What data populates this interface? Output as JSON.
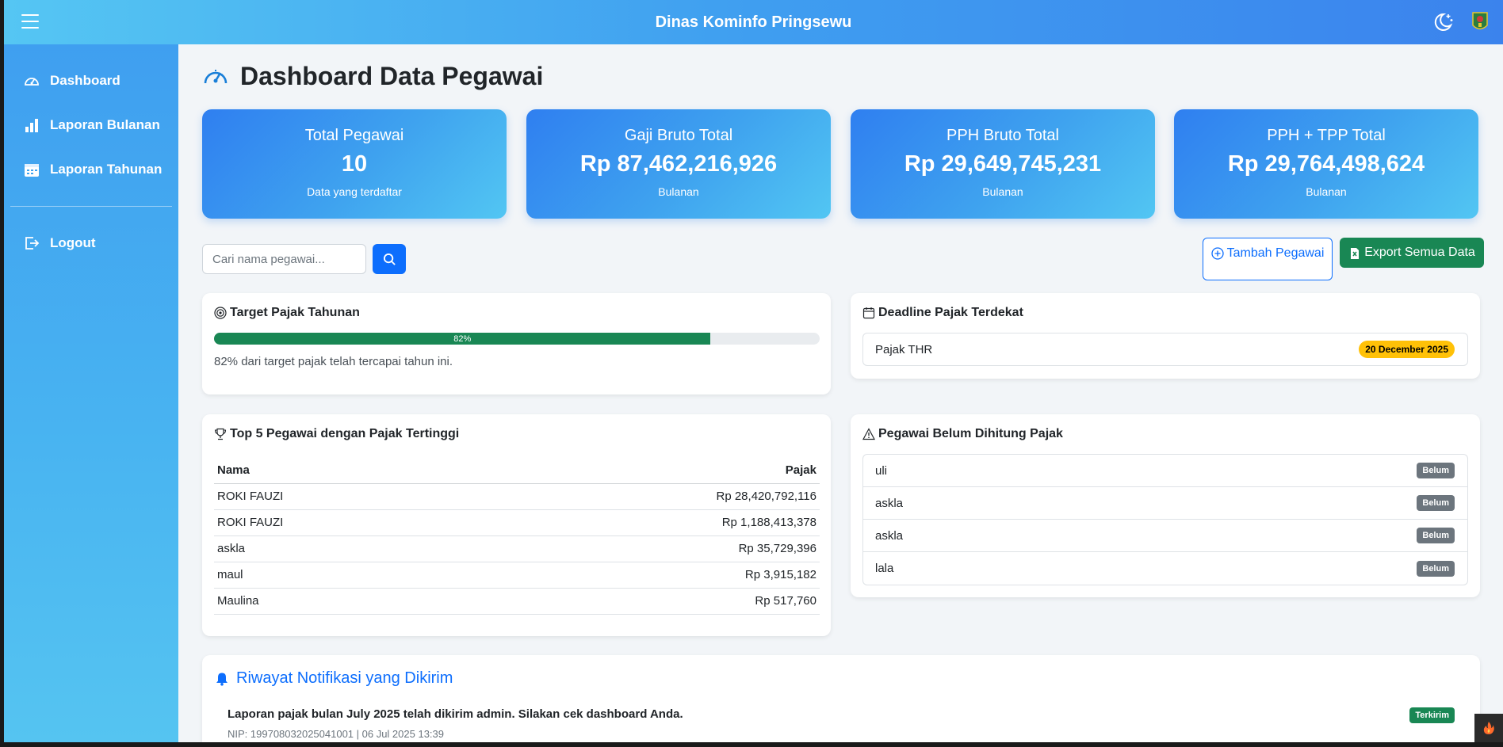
{
  "header": {
    "app_title": "Dinas Kominfo Pringsewu",
    "menu_icon": "hamburger-icon",
    "theme_icon": "moon-stars-icon",
    "logo_icon": "regency-emblem-icon"
  },
  "sidebar": {
    "items": [
      {
        "label": "Dashboard",
        "icon": "speedometer-icon"
      },
      {
        "label": "Laporan Bulanan",
        "icon": "bar-chart-icon"
      },
      {
        "label": "Laporan Tahunan",
        "icon": "calendar-icon"
      }
    ],
    "logout": {
      "label": "Logout",
      "icon": "logout-icon"
    }
  },
  "page": {
    "title": "Dashboard Data Pegawai",
    "title_icon": "speedometer-icon"
  },
  "stats": [
    {
      "title": "Total Pegawai",
      "value": "10",
      "sub": "Data yang terdaftar"
    },
    {
      "title": "Gaji Bruto Total",
      "value": "Rp 87,462,216,926",
      "sub": "Bulanan"
    },
    {
      "title": "PPH Bruto Total",
      "value": "Rp 29,649,745,231",
      "sub": "Bulanan"
    },
    {
      "title": "PPH + TPP Total",
      "value": "Rp 29,764,498,624",
      "sub": "Bulanan"
    }
  ],
  "search": {
    "placeholder": "Cari nama pegawai...",
    "button_icon": "search-icon"
  },
  "actions": {
    "add_label": "Tambah Pegawai",
    "export_label": "Export Semua Data"
  },
  "target": {
    "title": "Target Pajak Tahunan",
    "progress_percent": 82,
    "progress_label": "82%",
    "note": "82% dari target pajak telah tercapai tahun ini."
  },
  "deadline": {
    "title": "Deadline Pajak Terdekat",
    "item_name": "Pajak THR",
    "item_date": "20 December 2025"
  },
  "top5": {
    "title": "Top 5 Pegawai dengan Pajak Tertinggi",
    "headers": {
      "name": "Nama",
      "tax": "Pajak"
    },
    "rows": [
      {
        "name": "ROKI FAUZI",
        "tax": "Rp 28,420,792,116"
      },
      {
        "name": "ROKI FAUZI",
        "tax": "Rp 1,188,413,378"
      },
      {
        "name": "askla",
        "tax": "Rp 35,729,396"
      },
      {
        "name": "maul",
        "tax": "Rp 3,915,182"
      },
      {
        "name": "Maulina",
        "tax": "Rp 517,760"
      }
    ]
  },
  "pending": {
    "title": "Pegawai Belum Dihitung Pajak",
    "rows": [
      {
        "name": "uli",
        "status": "Belum"
      },
      {
        "name": "askla",
        "status": "Belum"
      },
      {
        "name": "askla",
        "status": "Belum"
      },
      {
        "name": "lala",
        "status": "Belum"
      }
    ]
  },
  "notifications": {
    "title": "Riwayat Notifikasi yang Dikirim",
    "items": [
      {
        "message": "Laporan pajak bulan July 2025 telah dikirim admin. Silakan cek dashboard Anda.",
        "meta": "NIP: 199708032025041001 | 06 Jul 2025 13:39",
        "status": "Terkirim"
      }
    ]
  },
  "colors": {
    "accent": "#0d6efd",
    "success": "#198754",
    "warning": "#ffc107",
    "secondary": "#6c757d"
  }
}
